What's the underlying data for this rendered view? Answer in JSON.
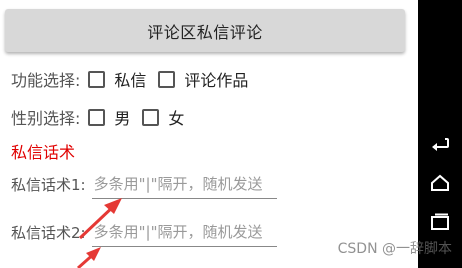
{
  "top_button": {
    "label": "评论区私信评论"
  },
  "function_row": {
    "label": "功能选择:",
    "options": [
      {
        "label": "私信",
        "checked": false
      },
      {
        "label": "评论作品",
        "checked": false
      }
    ]
  },
  "gender_row": {
    "label": "性别选择:",
    "options": [
      {
        "label": "男",
        "checked": false
      },
      {
        "label": "女",
        "checked": false
      }
    ]
  },
  "section": {
    "title": "私信话术",
    "title_color": "#e00000"
  },
  "fields": [
    {
      "label": "私信话术1:",
      "value": "",
      "placeholder": "多条用\"|\"隔开，随机发送"
    },
    {
      "label": "私信话术2:",
      "value": "",
      "placeholder": "多条用\"|\"隔开，随机发送"
    }
  ],
  "watermark": "CSDN @一辞脚本",
  "icons": {
    "back": "back-icon",
    "home": "home-icon",
    "recents": "recents-icon",
    "annotation": "red-arrow-icon"
  },
  "colors": {
    "arrow": "#e53935",
    "nav_bar": "#000000"
  }
}
